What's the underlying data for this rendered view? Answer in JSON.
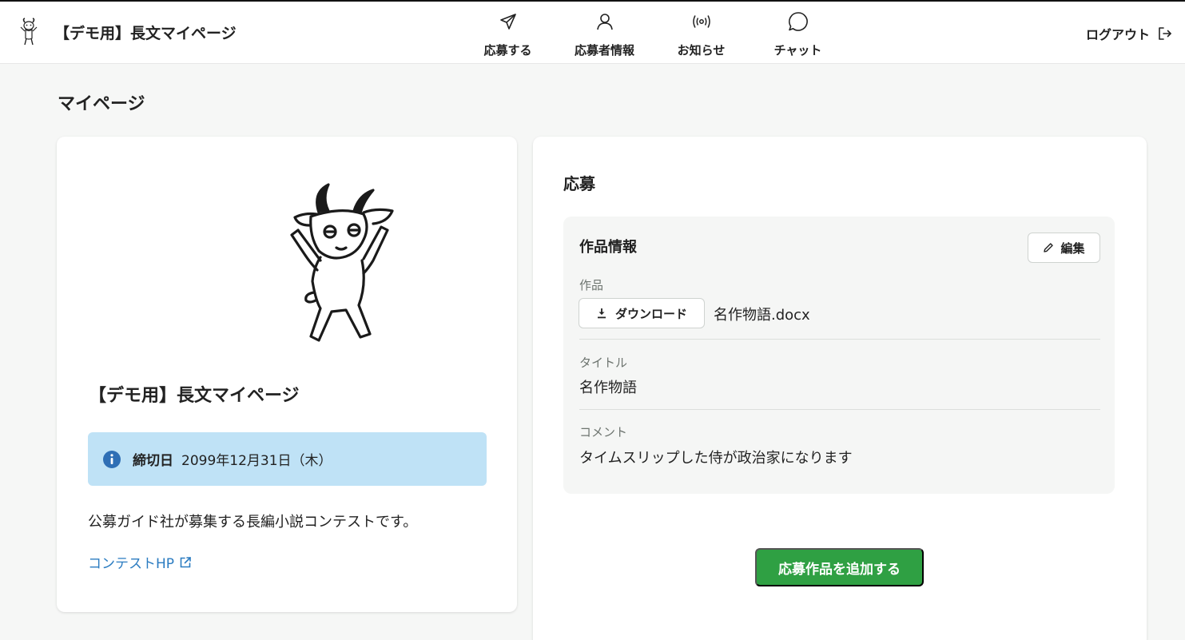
{
  "header": {
    "title": "【デモ用】長文マイページ",
    "logo": "goat-logo",
    "nav": [
      {
        "label": "応募する",
        "icon": "send-icon"
      },
      {
        "label": "応募者情報",
        "icon": "user-icon"
      },
      {
        "label": "お知らせ",
        "icon": "broadcast-icon"
      },
      {
        "label": "チャット",
        "icon": "chat-icon"
      }
    ],
    "logout_label": "ログアウト"
  },
  "page_title": "マイページ",
  "contest": {
    "name": "【デモ用】長文マイページ",
    "deadline_label": "締切日",
    "deadline_value": "2099年12月31日（木）",
    "description": "公募ガイド社が募集する長編小説コンテストです。",
    "link_label": "コンテストHP"
  },
  "application": {
    "section_title": "応募",
    "work_heading": "作品情報",
    "edit_label": "編集",
    "work_label": "作品",
    "download_label": "ダウンロード",
    "file_name": "名作物語.docx",
    "title_label": "タイトル",
    "title_value": "名作物語",
    "comment_label": "コメント",
    "comment_value": "タイムスリップした侍が政治家になります",
    "add_button_label": "応募作品を追加する"
  },
  "colors": {
    "accent_green": "#2fa043",
    "info_bg": "#bfe2f6",
    "info_icon": "#2f6fb5",
    "link": "#2b7cc1",
    "page_bg": "#f6f7f6"
  }
}
